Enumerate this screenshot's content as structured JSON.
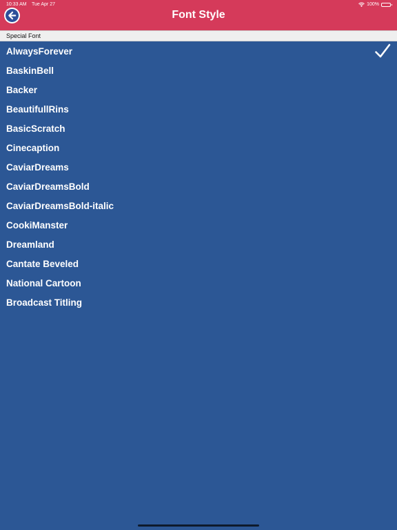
{
  "status_bar": {
    "time": "10:33 AM",
    "date": "Tue Apr 27",
    "battery": "100%",
    "wifi_icon": "wifi-icon",
    "battery_icon": "battery-icon"
  },
  "header": {
    "title": "Font Style",
    "back_icon": "back-arrow-icon",
    "background": "#d53a5a"
  },
  "section": {
    "title": "Special Font"
  },
  "fonts": [
    {
      "label": "AlwaysForever",
      "selected": true
    },
    {
      "label": "BaskinBell",
      "selected": false
    },
    {
      "label": "Backer",
      "selected": false
    },
    {
      "label": "BeautifullRins",
      "selected": false
    },
    {
      "label": "BasicScratch",
      "selected": false
    },
    {
      "label": "Cinecaption",
      "selected": false
    },
    {
      "label": "CaviarDreams",
      "selected": false
    },
    {
      "label": "CaviarDreamsBold",
      "selected": false
    },
    {
      "label": "CaviarDreamsBold-italic",
      "selected": false
    },
    {
      "label": "CookiManster",
      "selected": false
    },
    {
      "label": "Dreamland",
      "selected": false
    },
    {
      "label": "Cantate Beveled",
      "selected": false
    },
    {
      "label": "National Cartoon",
      "selected": false
    },
    {
      "label": "Broadcast Titling",
      "selected": false
    }
  ],
  "colors": {
    "list_background": "#2c5795",
    "text": "#ffffff"
  }
}
